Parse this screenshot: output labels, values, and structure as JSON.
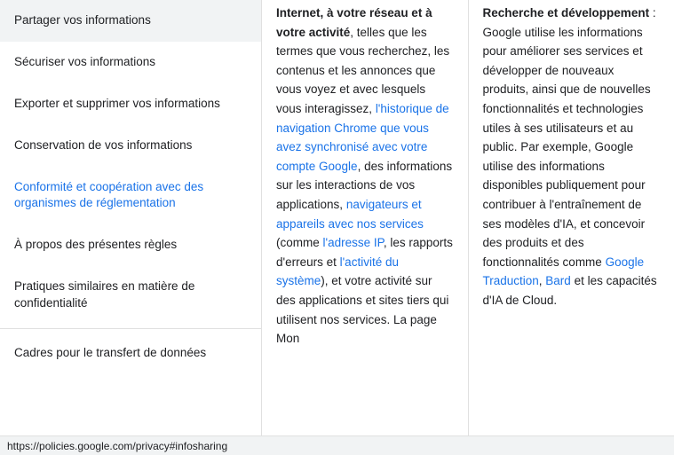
{
  "sidebar": {
    "items": [
      {
        "id": "partager",
        "label": "Partager vos informations",
        "active": false
      },
      {
        "id": "securiser",
        "label": "Sécuriser vos informations",
        "active": false
      },
      {
        "id": "exporter",
        "label": "Exporter et supprimer vos informations",
        "active": false
      },
      {
        "id": "conservation",
        "label": "Conservation de vos informations",
        "active": false
      },
      {
        "id": "conformite",
        "label": "Conformité et coopération avec des organismes de réglementation",
        "active": true
      },
      {
        "id": "apropos",
        "label": "À propos des présentes règles",
        "active": false
      },
      {
        "id": "pratiques",
        "label": "Pratiques similaires en matière de confidentialité",
        "active": false
      },
      {
        "id": "cadres",
        "label": "Cadres pour le transfert de données",
        "active": false
      }
    ]
  },
  "content": {
    "left_column": {
      "paragraphs": [
        {
          "html": "Internet, à votre réseau et à votre activité, telles que les termes que vous recherchez, les contenus et les annonces que vous voyez et avec lesquels vous interagissez, l'historique de navigation Chrome que vous avez synchronisé avec votre compte Google, des informations sur les interactions de vos applications, navigateurs et appareils avec nos services (comme l'adresse IP, les rapports d'erreurs et l'activité du système), et votre activité sur des applications et sites tiers qui utilisent nos services. La page Mon"
        }
      ]
    },
    "right_column": {
      "title": "Recherche et développement",
      "paragraphs": [
        {
          "html": "Google utilise les informations pour améliorer ses services et développer de nouveaux produits, ainsi que de nouvelles fonctionnalités et technologies utiles à ses utilisateurs et au public. Par exemple, Google utilise des informations disponibles publiquement pour contribuer à l'entraînement de ses modèles d'IA, et concevoir des produits et des fonctionnalités comme Google Traduction, Bard et les capacités d'IA de Cloud."
        }
      ]
    }
  },
  "status_bar": {
    "url": "https://policies.google.com/privacy#infosharing"
  }
}
